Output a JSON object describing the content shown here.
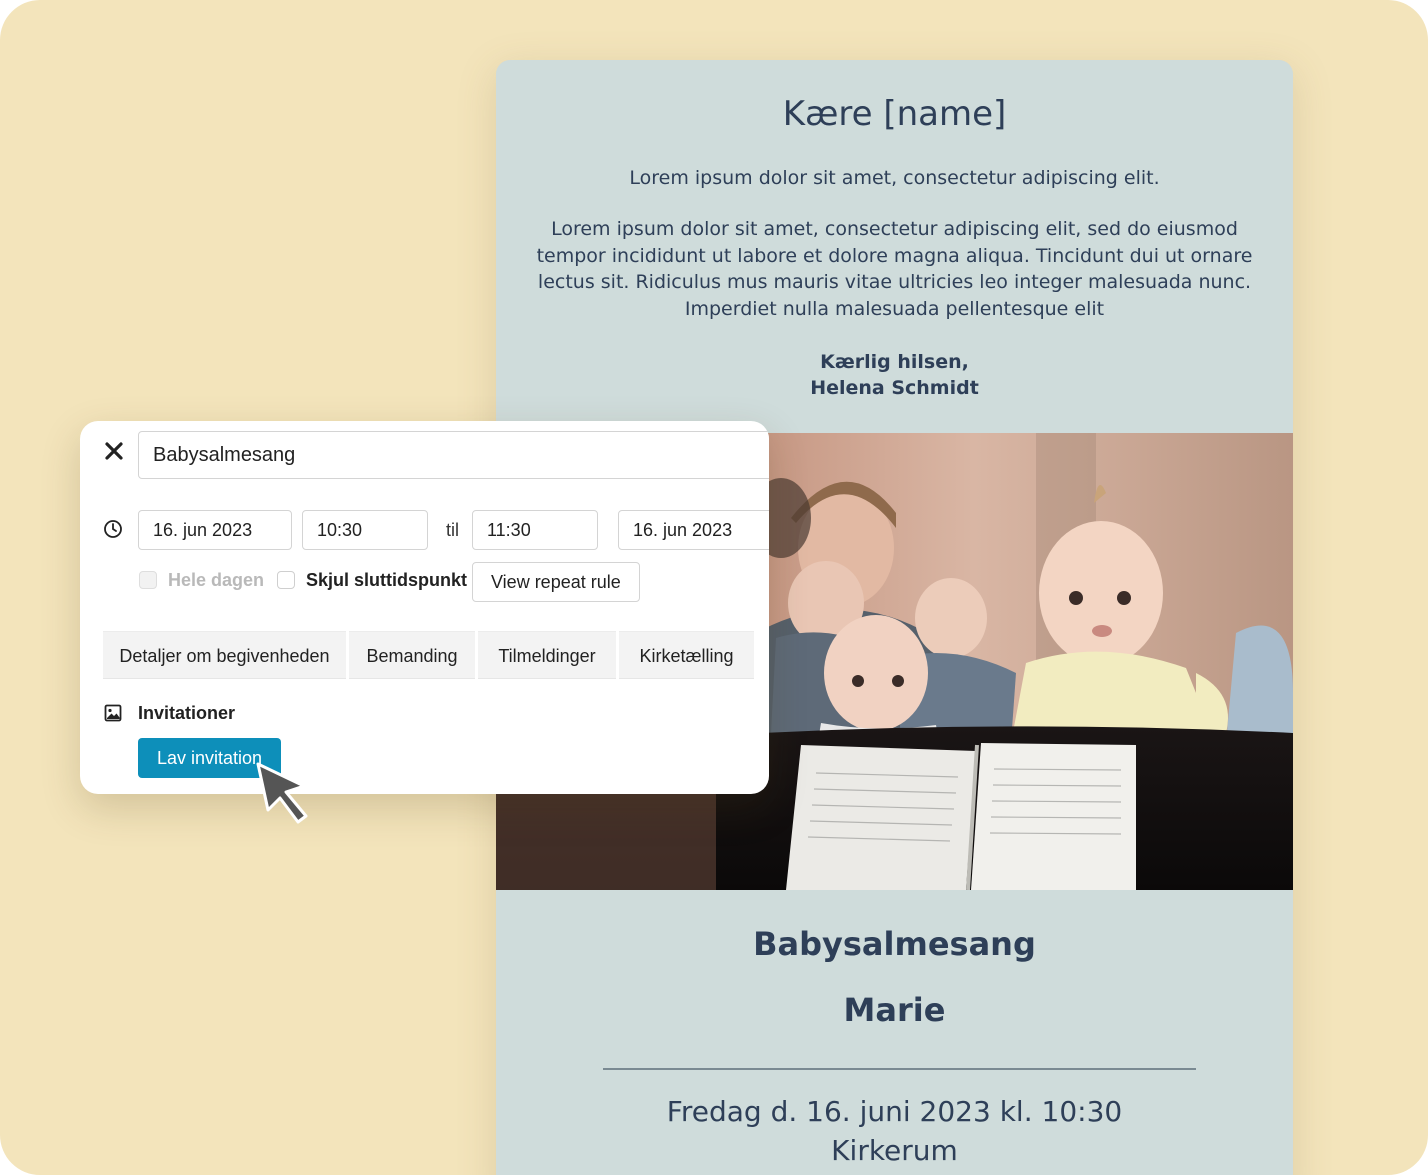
{
  "invitation": {
    "greeting": "Kære [name]",
    "intro": "Lorem ipsum dolor sit amet, consectetur adipiscing elit.",
    "body": "Lorem ipsum dolor sit amet, consectetur adipiscing elit, sed do eiusmod tempor incididunt ut labore et dolore magna aliqua. Tincidunt dui ut ornare lectus sit. Ridiculus mus mauris vitae ultricies leo integer malesuada nunc. Imperdiet nulla malesuada pellentesque elit",
    "signoff": "Kærlig hilsen,",
    "signature": "Helena Schmidt",
    "event_title": "Babysalmesang",
    "event_name": "Marie",
    "event_date": "Fredag d. 16. juni 2023 kl. 10:30",
    "event_place": "Kirkerum"
  },
  "editor": {
    "title_value": "Babysalmesang",
    "start_date": "16. jun 2023",
    "start_time": "10:30",
    "til_label": "til",
    "end_time": "11:30",
    "end_date": "16. jun 2023",
    "all_day_label": "Hele dagen",
    "hide_end_label": "Skjul sluttidspunkt",
    "repeat_button": "View repeat rule",
    "tabs": [
      {
        "label": "Detaljer om begivenheden"
      },
      {
        "label": "Bemanding"
      },
      {
        "label": "Tilmeldinger"
      },
      {
        "label": "Kirketælling"
      }
    ],
    "section_label": "Invitationer",
    "primary_button": "Lav invitation"
  },
  "colors": {
    "background": "#f3e4bb",
    "card": "#cfdcdb",
    "card_text": "#2e3f58",
    "primary": "#0d8fba"
  }
}
